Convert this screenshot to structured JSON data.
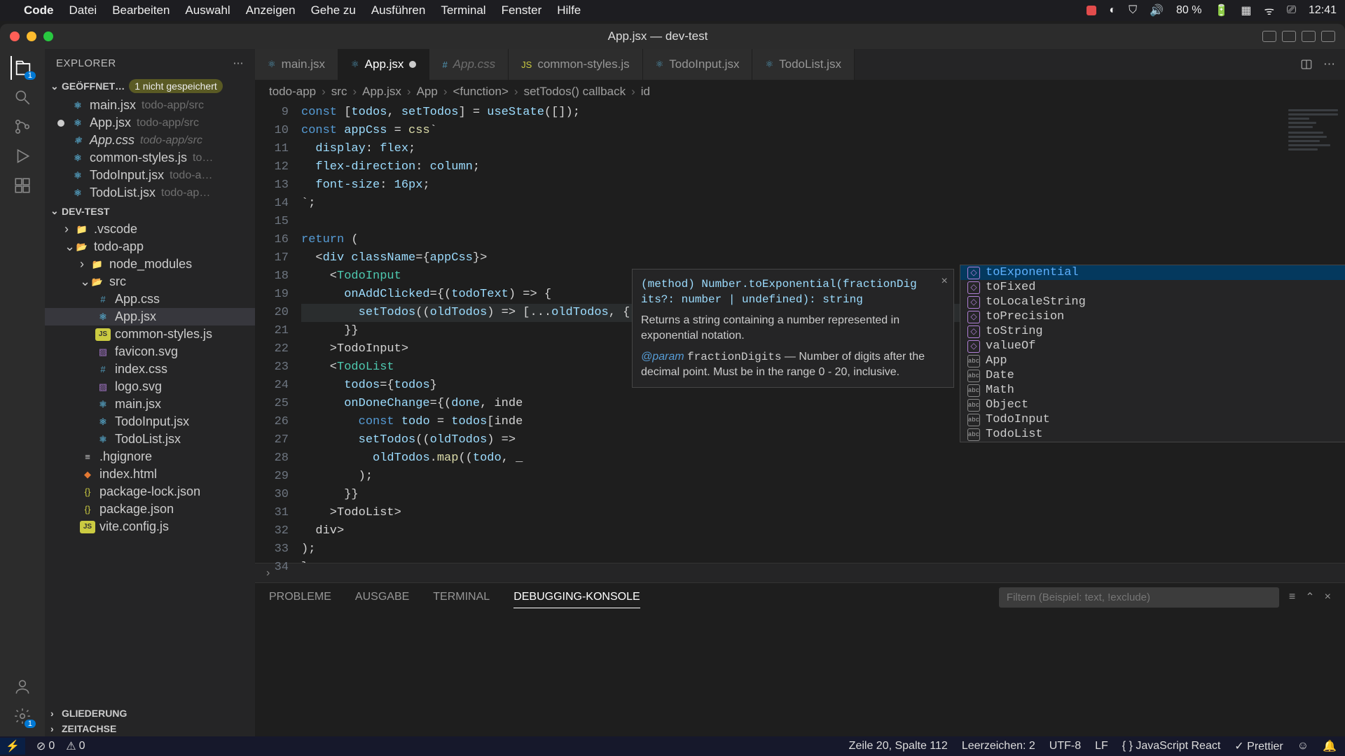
{
  "menubar": {
    "app": "Code",
    "items": [
      "Datei",
      "Bearbeiten",
      "Auswahl",
      "Anzeigen",
      "Gehe zu",
      "Ausführen",
      "Terminal",
      "Fenster",
      "Hilfe"
    ],
    "battery": "80 %",
    "time": "12:41"
  },
  "window": {
    "title": "App.jsx — dev-test"
  },
  "sidebar": {
    "title": "EXPLORER",
    "open_editors": {
      "label": "GEÖFFNET…",
      "unsaved": "1 nicht gespeichert",
      "items": [
        {
          "name": "main.jsx",
          "path": "todo-app/src",
          "unsaved": false
        },
        {
          "name": "App.jsx",
          "path": "todo-app/src",
          "unsaved": true
        },
        {
          "name": "App.css",
          "path": "todo-app/src",
          "unsaved": false,
          "italic": true
        },
        {
          "name": "common-styles.js",
          "path": "to…",
          "unsaved": false
        },
        {
          "name": "TodoInput.jsx",
          "path": "todo-a…",
          "unsaved": false
        },
        {
          "name": "TodoList.jsx",
          "path": "todo-ap…",
          "unsaved": false
        }
      ]
    },
    "project": {
      "label": "DEV-TEST",
      "tree": [
        {
          "name": ".vscode",
          "depth": 1,
          "type": "folder"
        },
        {
          "name": "todo-app",
          "depth": 1,
          "type": "folder-open"
        },
        {
          "name": "node_modules",
          "depth": 2,
          "type": "folder"
        },
        {
          "name": "src",
          "depth": 2,
          "type": "folder-open"
        },
        {
          "name": "App.css",
          "depth": 3,
          "type": "css"
        },
        {
          "name": "App.jsx",
          "depth": 3,
          "type": "jsx",
          "selected": true
        },
        {
          "name": "common-styles.js",
          "depth": 3,
          "type": "js"
        },
        {
          "name": "favicon.svg",
          "depth": 3,
          "type": "svg"
        },
        {
          "name": "index.css",
          "depth": 3,
          "type": "css"
        },
        {
          "name": "logo.svg",
          "depth": 3,
          "type": "svg"
        },
        {
          "name": "main.jsx",
          "depth": 3,
          "type": "jsx"
        },
        {
          "name": "TodoInput.jsx",
          "depth": 3,
          "type": "jsx"
        },
        {
          "name": "TodoList.jsx",
          "depth": 3,
          "type": "jsx"
        },
        {
          "name": ".hgignore",
          "depth": 2,
          "type": "file"
        },
        {
          "name": "index.html",
          "depth": 2,
          "type": "html"
        },
        {
          "name": "package-lock.json",
          "depth": 2,
          "type": "json"
        },
        {
          "name": "package.json",
          "depth": 2,
          "type": "json"
        },
        {
          "name": "vite.config.js",
          "depth": 2,
          "type": "js"
        }
      ]
    },
    "outline": "GLIEDERUNG",
    "timeline": "ZEITACHSE"
  },
  "tabs": [
    {
      "label": "main.jsx",
      "type": "jsx"
    },
    {
      "label": "App.jsx",
      "type": "jsx",
      "active": true,
      "unsaved": true
    },
    {
      "label": "App.css",
      "type": "css",
      "dim": true
    },
    {
      "label": "common-styles.js",
      "type": "js"
    },
    {
      "label": "TodoInput.jsx",
      "type": "jsx"
    },
    {
      "label": "TodoList.jsx",
      "type": "jsx"
    }
  ],
  "breadcrumbs": [
    "todo-app",
    "src",
    "App.jsx",
    "App",
    "<function>",
    "setTodos() callback",
    "id"
  ],
  "code": {
    "start": 9,
    "lines": [
      "const [todos, setTodos] = useState([]);",
      "const appCss = css`",
      "  display: flex;",
      "  flex-direction: column;",
      "  font-size: 16px;",
      "`;",
      "",
      "return (",
      "  <div className={appCss}>",
      "    <TodoInput",
      "      onAddClicked={(todoText) => {",
      "        setTodos((oldTodos) => [...oldTodos, { text: todoText, done: false, id: (Date.now() * Math.random()). }]);",
      "      }}",
      "    ></TodoInput>",
      "    <TodoList",
      "      todos={todos}",
      "      onDoneChange={(done, inde",
      "        const todo = todos[inde",
      "        setTodos((oldTodos) =>",
      "          oldTodos.map((todo, _",
      "        );",
      "      }}",
      "    ></TodoList>",
      "  </div>",
      ");"
    ],
    "extra_line": "}"
  },
  "hover": {
    "signature": "(method) Number.toExponential(fractionDig its?: number | undefined): string",
    "desc": "Returns a string containing a number represented in exponential notation.",
    "param_label": "@param",
    "param_name": "fractionDigits",
    "param_desc": "— Number of digits after the decimal point. Must be in the range 0 - 20, inclusive."
  },
  "suggest": [
    {
      "name": "toExponential",
      "kind": "method",
      "selected": true
    },
    {
      "name": "toFixed",
      "kind": "method"
    },
    {
      "name": "toLocaleString",
      "kind": "method"
    },
    {
      "name": "toPrecision",
      "kind": "method"
    },
    {
      "name": "toString",
      "kind": "method"
    },
    {
      "name": "valueOf",
      "kind": "method"
    },
    {
      "name": "App",
      "kind": "word"
    },
    {
      "name": "Date",
      "kind": "word"
    },
    {
      "name": "Math",
      "kind": "word"
    },
    {
      "name": "Object",
      "kind": "word"
    },
    {
      "name": "TodoInput",
      "kind": "word"
    },
    {
      "name": "TodoList",
      "kind": "word"
    }
  ],
  "panel": {
    "tabs": [
      "PROBLEME",
      "AUSGABE",
      "TERMINAL",
      "DEBUGGING-KONSOLE"
    ],
    "active": 3,
    "filter_placeholder": "Filtern (Beispiel: text, !exclude)"
  },
  "statusbar": {
    "errors": "0",
    "warnings": "0",
    "cursor": "Zeile 20, Spalte 112",
    "spaces": "Leerzeichen: 2",
    "encoding": "UTF-8",
    "eol": "LF",
    "lang": "JavaScript React",
    "prettier": "Prettier"
  }
}
